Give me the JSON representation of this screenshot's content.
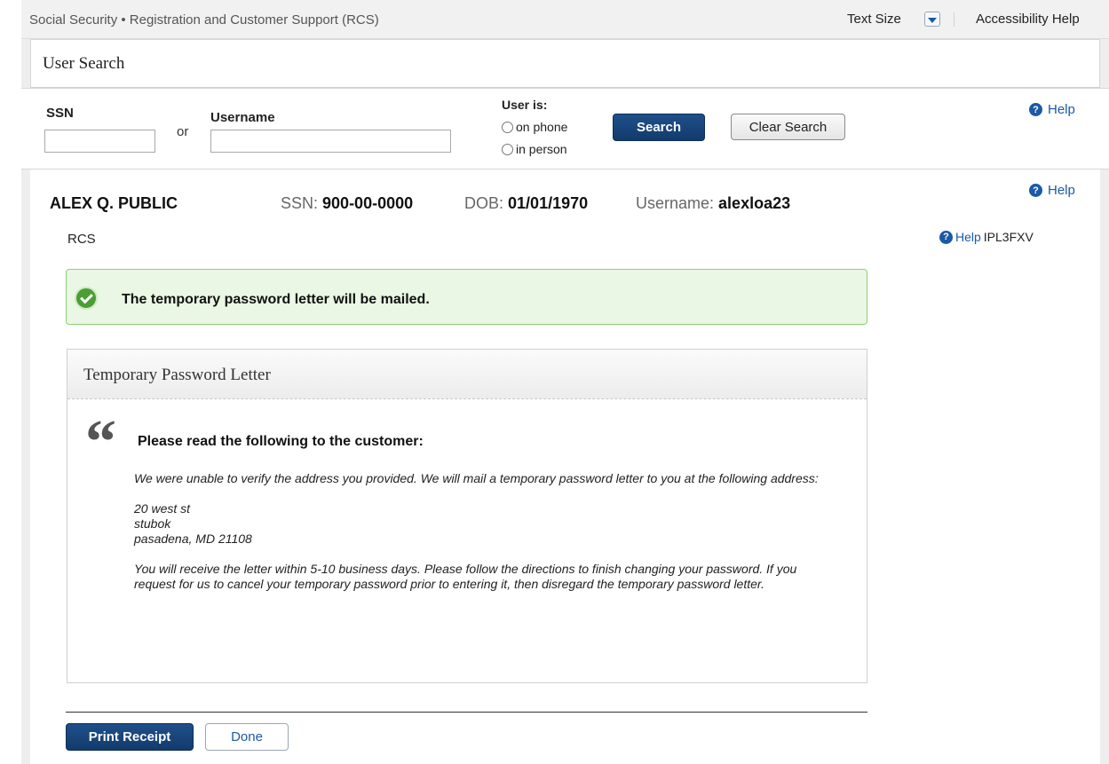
{
  "topbar": {
    "app_title": "Social Security • Registration and Customer Support (RCS)",
    "text_size_label": "Text Size",
    "accessibility_help": "Accessibility Help"
  },
  "page_title": "User Search",
  "search": {
    "ssn_label": "SSN",
    "ssn_value": "",
    "or_label": "or",
    "username_label": "Username",
    "username_value": "",
    "user_is_label": "User is:",
    "options": [
      "on phone",
      "in person"
    ],
    "search_button": "Search",
    "clear_button": "Clear Search",
    "help": "Help"
  },
  "customer": {
    "name": "ALEX Q. PUBLIC",
    "ssn_label": "SSN:",
    "ssn": "900-00-0000",
    "dob_label": "DOB:",
    "dob": "01/01/1970",
    "username_label": "Username:",
    "username": "alexloa23",
    "help": "Help",
    "rcs_label": "RCS",
    "screen_help": "Help",
    "screen_code": "IPL3FXV"
  },
  "success_message": "The temporary password letter will be mailed.",
  "letter": {
    "title": "Temporary Password Letter",
    "instruction": "Please read the following to the customer:",
    "paragraph1": "We were unable to verify the address you provided. We will mail a temporary password letter to you at the following address:",
    "address": [
      "20 west st",
      "stubok",
      "pasadena, MD 21108"
    ],
    "paragraph2": "You will receive the letter within 5-10 business days. Please follow the directions to finish changing your password. If you request for us to cancel your temporary password prior to entering it, then disregard the temporary password letter."
  },
  "actions": {
    "print_receipt": "Print Receipt",
    "done": "Done"
  },
  "colors": {
    "primary_button": "#123b6d",
    "link": "#1a5aa6",
    "success_bg": "#eaf7e4",
    "success_border": "#8fd07a",
    "success_icon": "#4a9e34"
  },
  "icons": [
    "chevron-down-icon",
    "help-icon",
    "check-circle-icon",
    "quote-icon",
    "radio-icon"
  ]
}
